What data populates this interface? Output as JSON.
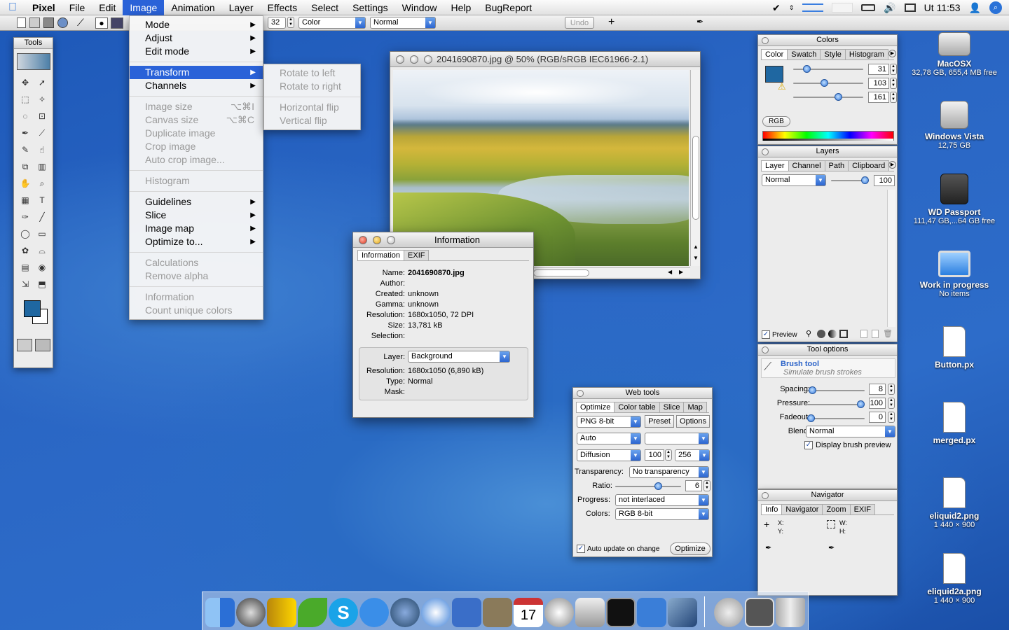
{
  "menubar": {
    "app": "Pixel",
    "items": [
      "File",
      "Edit",
      "Image",
      "Animation",
      "Layer",
      "Effects",
      "Select",
      "Settings",
      "Window",
      "Help",
      "BugReport"
    ],
    "clock": "Ut 11:53"
  },
  "optbar": {
    "size": "32",
    "mode": "Color",
    "blend": "Normal",
    "undo": "Undo"
  },
  "image_menu": {
    "items": [
      {
        "label": "Mode",
        "sub": true
      },
      {
        "label": "Adjust",
        "sub": true
      },
      {
        "label": "Edit mode",
        "sub": true
      },
      {
        "sep": true
      },
      {
        "label": "Transform",
        "sub": true,
        "sel": true
      },
      {
        "label": "Channels",
        "sub": true
      },
      {
        "sep": true
      },
      {
        "label": "Image size",
        "sc": "⌥⌘I",
        "dis": true
      },
      {
        "label": "Canvas size",
        "sc": "⌥⌘C",
        "dis": true
      },
      {
        "label": "Duplicate image",
        "dis": true
      },
      {
        "label": "Crop image",
        "dis": true
      },
      {
        "label": "Auto crop image...",
        "dis": true
      },
      {
        "sep": true
      },
      {
        "label": "Histogram",
        "dis": true
      },
      {
        "sep": true
      },
      {
        "label": "Guidelines",
        "sub": true
      },
      {
        "label": "Slice",
        "sub": true
      },
      {
        "label": "Image map",
        "sub": true
      },
      {
        "label": "Optimize to...",
        "sub": true
      },
      {
        "sep": true
      },
      {
        "label": "Calculations",
        "dis": true
      },
      {
        "label": "Remove alpha",
        "dis": true
      },
      {
        "sep": true
      },
      {
        "label": "Information",
        "dis": true
      },
      {
        "label": "Count unique colors",
        "dis": true
      }
    ]
  },
  "transform_menu": {
    "items": [
      {
        "label": "Rotate to left",
        "dis": true
      },
      {
        "label": "Rotate to right",
        "dis": true
      },
      {
        "sep": true
      },
      {
        "label": "Horizontal flip",
        "dis": true
      },
      {
        "label": "Vertical flip",
        "dis": true
      }
    ]
  },
  "tools": {
    "title": "Tools"
  },
  "image_window": {
    "title": "2041690870.jpg @ 50% (RGB/sRGB IEC61966-2.1)"
  },
  "info_window": {
    "title": "Information",
    "tabs": [
      "Information",
      "EXIF"
    ],
    "rows": [
      {
        "k": "Name:",
        "v": "2041690870.jpg"
      },
      {
        "k": "Author:",
        "v": ""
      },
      {
        "k": "Created:",
        "v": "unknown"
      },
      {
        "k": "Gamma:",
        "v": "unknown"
      },
      {
        "k": "Resolution:",
        "v": "1680x1050, 72 DPI"
      },
      {
        "k": "Size:",
        "v": "13,781 kB"
      },
      {
        "k": "Selection:",
        "v": ""
      }
    ],
    "layer_label": "Layer:",
    "layer_value": "Background",
    "rows2": [
      {
        "k": "Resolution:",
        "v": "1680x1050 (6,890 kB)"
      },
      {
        "k": "Type:",
        "v": "Normal"
      },
      {
        "k": "Mask:",
        "v": ""
      }
    ]
  },
  "colors_panel": {
    "title": "Colors",
    "tabs": [
      "Color",
      "Swatch",
      "Style",
      "Histogram"
    ],
    "r": "31",
    "g": "103",
    "b": "161",
    "mode": "RGB",
    "color": "#1f67a1"
  },
  "layers_panel": {
    "title": "Layers",
    "tabs": [
      "Layer",
      "Channel",
      "Path",
      "Clipboard"
    ],
    "blend": "Normal",
    "opacity": "100",
    "preview": "Preview"
  },
  "tool_options": {
    "title": "Tool options",
    "tool": "Brush tool",
    "desc": "Simulate brush strokes",
    "spacing_label": "Spacing:",
    "spacing": "8",
    "pressure_label": "Pressure:",
    "pressure": "100",
    "fadeout_label": "Fadeout:",
    "fadeout": "0",
    "blend_label": "Blend:",
    "blend": "Normal",
    "display": "Display brush preview"
  },
  "navigator": {
    "title": "Navigator",
    "tabs": [
      "Info",
      "Navigator",
      "Zoom",
      "EXIF"
    ],
    "x": "X:",
    "y": "Y:",
    "w": "W:",
    "h": "H:"
  },
  "web_tools": {
    "title": "Web tools",
    "tabs": [
      "Optimize",
      "Color table",
      "Slice",
      "Map"
    ],
    "format": "PNG 8-bit",
    "preset": "Preset",
    "options": "Options",
    "palette": "Auto",
    "dither": "Diffusion",
    "dither_amt": "100",
    "colors_n": "256",
    "transparency_label": "Transparency:",
    "transparency": "No transparency",
    "ratio_label": "Ratio:",
    "ratio": "6",
    "progress_label": "Progress:",
    "progress": "not interlaced",
    "colors_label": "Colors:",
    "colors": "RGB 8-bit",
    "auto": "Auto update on change",
    "optimize": "Optimize"
  },
  "desktop": [
    {
      "name": "MacOSX",
      "sub": "32,78 GB, 655,4 MB free"
    },
    {
      "name": "Windows Vista",
      "sub": "12,75 GB"
    },
    {
      "name": "WD Passport",
      "sub": "111,47 GB,...64 GB free"
    },
    {
      "name": "Work in progress",
      "sub": "No items"
    },
    {
      "name": "Button.px",
      "sub": ""
    },
    {
      "name": "merged.px",
      "sub": ""
    },
    {
      "name": "eliquid2.png",
      "sub": "1 440 × 900"
    },
    {
      "name": "eliquid2a.png",
      "sub": "1 440 × 900"
    }
  ]
}
